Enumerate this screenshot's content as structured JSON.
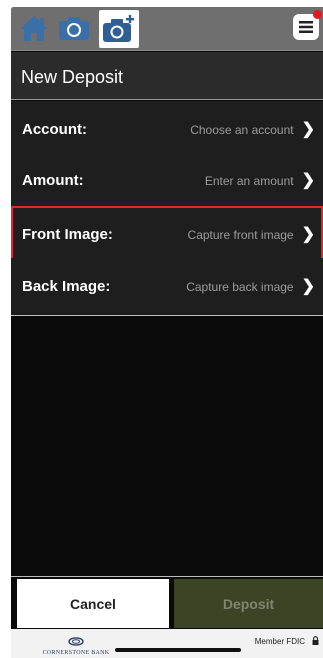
{
  "nav": {
    "icons": [
      "home-icon",
      "camera-icon",
      "deposit-camera-icon",
      "menu-icon"
    ],
    "active": "deposit-camera-icon",
    "notification_color": "#e11a1a"
  },
  "header": {
    "title": "New Deposit"
  },
  "form": {
    "rows": [
      {
        "label": "Account:",
        "hint": "Choose an account",
        "chevron": "❯"
      },
      {
        "label": "Amount:",
        "hint": "Enter an amount",
        "chevron": "❯"
      },
      {
        "label": "Front Image:",
        "hint": "Capture front image",
        "chevron": "❯",
        "highlighted": true
      },
      {
        "label": "Back Image:",
        "hint": "Capture back image",
        "chevron": "❯"
      }
    ]
  },
  "actions": {
    "cancel_label": "Cancel",
    "deposit_label": "Deposit"
  },
  "footer": {
    "bank_name": "CORNERSTONE BANK",
    "member_fdic": "Member FDIC"
  },
  "colors": {
    "highlight": "#e0262e",
    "deposit_button": "#3b4424"
  }
}
